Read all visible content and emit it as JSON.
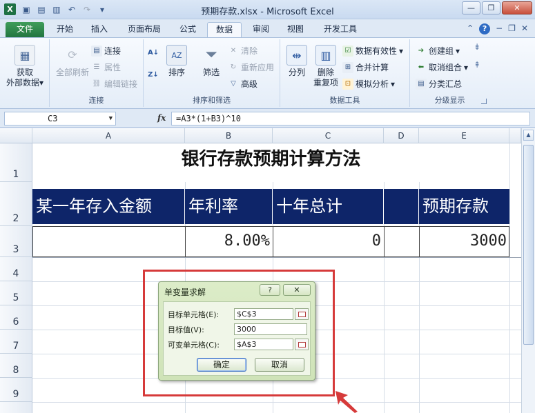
{
  "window": {
    "title": "预期存款.xlsx - Microsoft Excel",
    "app_icon": "X",
    "controls": {
      "minimize": "—",
      "restore": "❐",
      "close": "✕"
    }
  },
  "ribbon_tabs": [
    "文件",
    "开始",
    "插入",
    "页面布局",
    "公式",
    "数据",
    "审阅",
    "视图",
    "开发工具"
  ],
  "active_tab": "数据",
  "ribbon": {
    "get_external": {
      "line1": "获取",
      "line2": "外部数据"
    },
    "refresh_all": "全部刷新",
    "connections": {
      "connect": "连接",
      "properties": "属性",
      "edit_links": "编辑链接",
      "label": "连接"
    },
    "sort_filter": {
      "sort": "排序",
      "filter": "筛选",
      "clear": "清除",
      "reapply": "重新应用",
      "advanced": "高级",
      "label": "排序和筛选"
    },
    "data_tools": {
      "split": "分列",
      "remove_dup_1": "删除",
      "remove_dup_2": "重复项",
      "validation": "数据有效性",
      "consolidate": "合并计算",
      "whatif": "模拟分析",
      "label": "数据工具"
    },
    "outline": {
      "group": "创建组",
      "ungroup": "取消组合",
      "subtotal": "分类汇总",
      "label": "分级显示"
    }
  },
  "formula_bar": {
    "name_box": "C3",
    "fx": "fx",
    "formula": "=A3*(1+B3)^10"
  },
  "sheet": {
    "columns": [
      "A",
      "B",
      "C",
      "D",
      "E"
    ],
    "rows": [
      "1",
      "2",
      "3",
      "4",
      "5",
      "6",
      "7",
      "8",
      "9"
    ],
    "title": "银行存款预期计算方法",
    "headers": [
      "某一年存入金额",
      "年利率",
      "十年总计",
      "",
      "预期存款"
    ],
    "row3": [
      "",
      "8.00%",
      "0",
      "",
      "3000"
    ]
  },
  "dialog": {
    "title": "单变量求解",
    "help": "?",
    "close": "✕",
    "target_cell_label": "目标单元格(E):",
    "target_cell_value": "$C$3",
    "target_value_label": "目标值(V):",
    "target_value": "3000",
    "changing_cell_label": "可变单元格(C):",
    "changing_cell_value": "$A$3",
    "ok": "确定",
    "cancel": "取消"
  },
  "colors": {
    "header_fill": "#0e2569",
    "highlight_red": "#d63a3a",
    "file_tab_green": "#227540"
  }
}
